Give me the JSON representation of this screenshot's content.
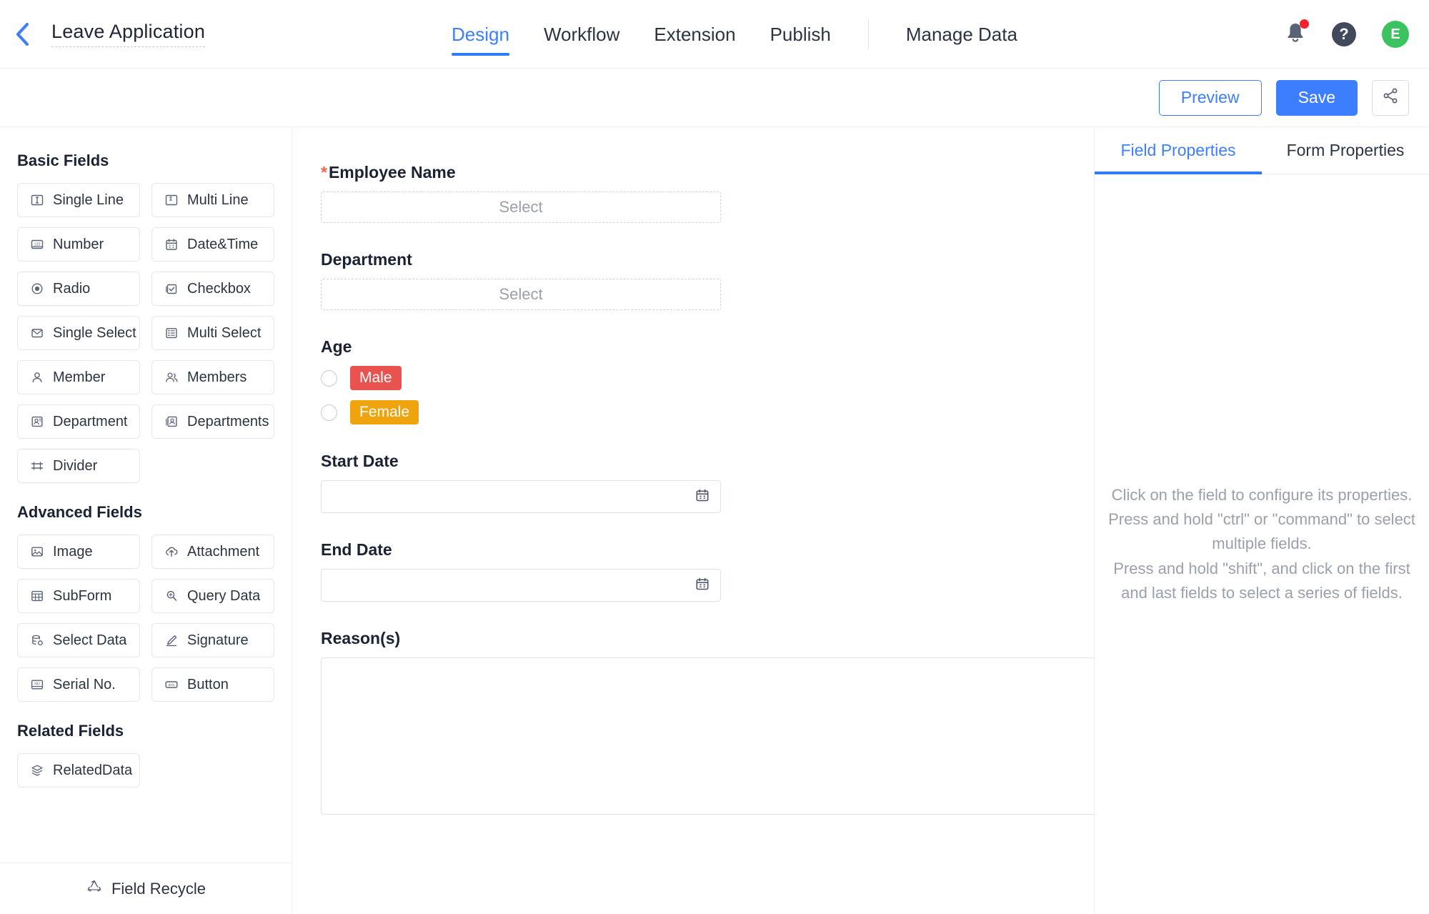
{
  "header": {
    "back_icon": "chevron-left-icon",
    "app_title": "Leave Application",
    "nav": [
      {
        "label": "Design",
        "active": true
      },
      {
        "label": "Workflow",
        "active": false
      },
      {
        "label": "Extension",
        "active": false
      },
      {
        "label": "Publish",
        "active": false
      }
    ],
    "nav_secondary": {
      "label": "Manage Data"
    },
    "notifications_icon": "bell-icon",
    "help_icon": "question-mark-icon",
    "help_label": "?",
    "avatar_initial": "E",
    "avatar_color": "#3ac35f"
  },
  "actionbar": {
    "preview_label": "Preview",
    "save_label": "Save",
    "share_icon": "share-icon"
  },
  "sidebar": {
    "groups": [
      {
        "title": "Basic Fields",
        "items": [
          {
            "label": "Single Line",
            "icon": "single-line-icon"
          },
          {
            "label": "Multi Line",
            "icon": "multi-line-icon"
          },
          {
            "label": "Number",
            "icon": "number-icon"
          },
          {
            "label": "Date&Time",
            "icon": "calendar-icon"
          },
          {
            "label": "Radio",
            "icon": "radio-icon"
          },
          {
            "label": "Checkbox",
            "icon": "checkbox-icon"
          },
          {
            "label": "Single Select",
            "icon": "single-select-icon"
          },
          {
            "label": "Multi Select",
            "icon": "multi-select-icon"
          },
          {
            "label": "Member",
            "icon": "member-icon"
          },
          {
            "label": "Members",
            "icon": "members-icon"
          },
          {
            "label": "Department",
            "icon": "department-icon"
          },
          {
            "label": "Departments",
            "icon": "departments-icon"
          },
          {
            "label": "Divider",
            "icon": "divider-icon"
          }
        ]
      },
      {
        "title": "Advanced Fields",
        "items": [
          {
            "label": "Image",
            "icon": "image-icon"
          },
          {
            "label": "Attachment",
            "icon": "attachment-upload-icon"
          },
          {
            "label": "SubForm",
            "icon": "subform-icon"
          },
          {
            "label": "Query Data",
            "icon": "query-data-icon"
          },
          {
            "label": "Select Data",
            "icon": "select-data-icon"
          },
          {
            "label": "Signature",
            "icon": "signature-pen-icon"
          },
          {
            "label": "Serial No.",
            "icon": "serial-number-icon"
          },
          {
            "label": "Button",
            "icon": "button-icon"
          }
        ]
      },
      {
        "title": "Related Fields",
        "items": [
          {
            "label": "RelatedData",
            "icon": "related-data-icon"
          }
        ]
      }
    ],
    "recycle": {
      "label": "Field Recycle",
      "icon": "recycle-icon"
    }
  },
  "form": {
    "fields": [
      {
        "type": "select",
        "label": "Employee Name",
        "required": true,
        "placeholder": "Select"
      },
      {
        "type": "select",
        "label": "Department",
        "required": false,
        "placeholder": "Select"
      },
      {
        "type": "radio",
        "label": "Age",
        "required": false,
        "options": [
          {
            "label": "Male",
            "color": "#e8524f",
            "checked": false
          },
          {
            "label": "Female",
            "color": "#efa30c",
            "checked": false
          }
        ]
      },
      {
        "type": "date",
        "label": "Start Date",
        "required": false,
        "value": "",
        "icon": "calendar-icon"
      },
      {
        "type": "date",
        "label": "End Date",
        "required": false,
        "value": "",
        "icon": "calendar-icon"
      },
      {
        "type": "textarea",
        "label": "Reason(s)",
        "required": false,
        "value": ""
      }
    ]
  },
  "rightpanel": {
    "tabs": [
      {
        "label": "Field Properties",
        "active": true
      },
      {
        "label": "Form Properties",
        "active": false
      }
    ],
    "hint_line1": "Click on the field to configure its properties.",
    "hint_line2": "Press and hold \"ctrl\" or \"command\" to select multiple fields.",
    "hint_line3": "Press and hold \"shift\", and click on the first and last fields to select a series of fields."
  },
  "colors": {
    "accent": "#3d7eff",
    "required": "#f5614a",
    "male_tag": "#e8524f",
    "female_tag": "#efa30c",
    "avatar": "#3ac35f",
    "notify_dot": "#f5222d"
  }
}
